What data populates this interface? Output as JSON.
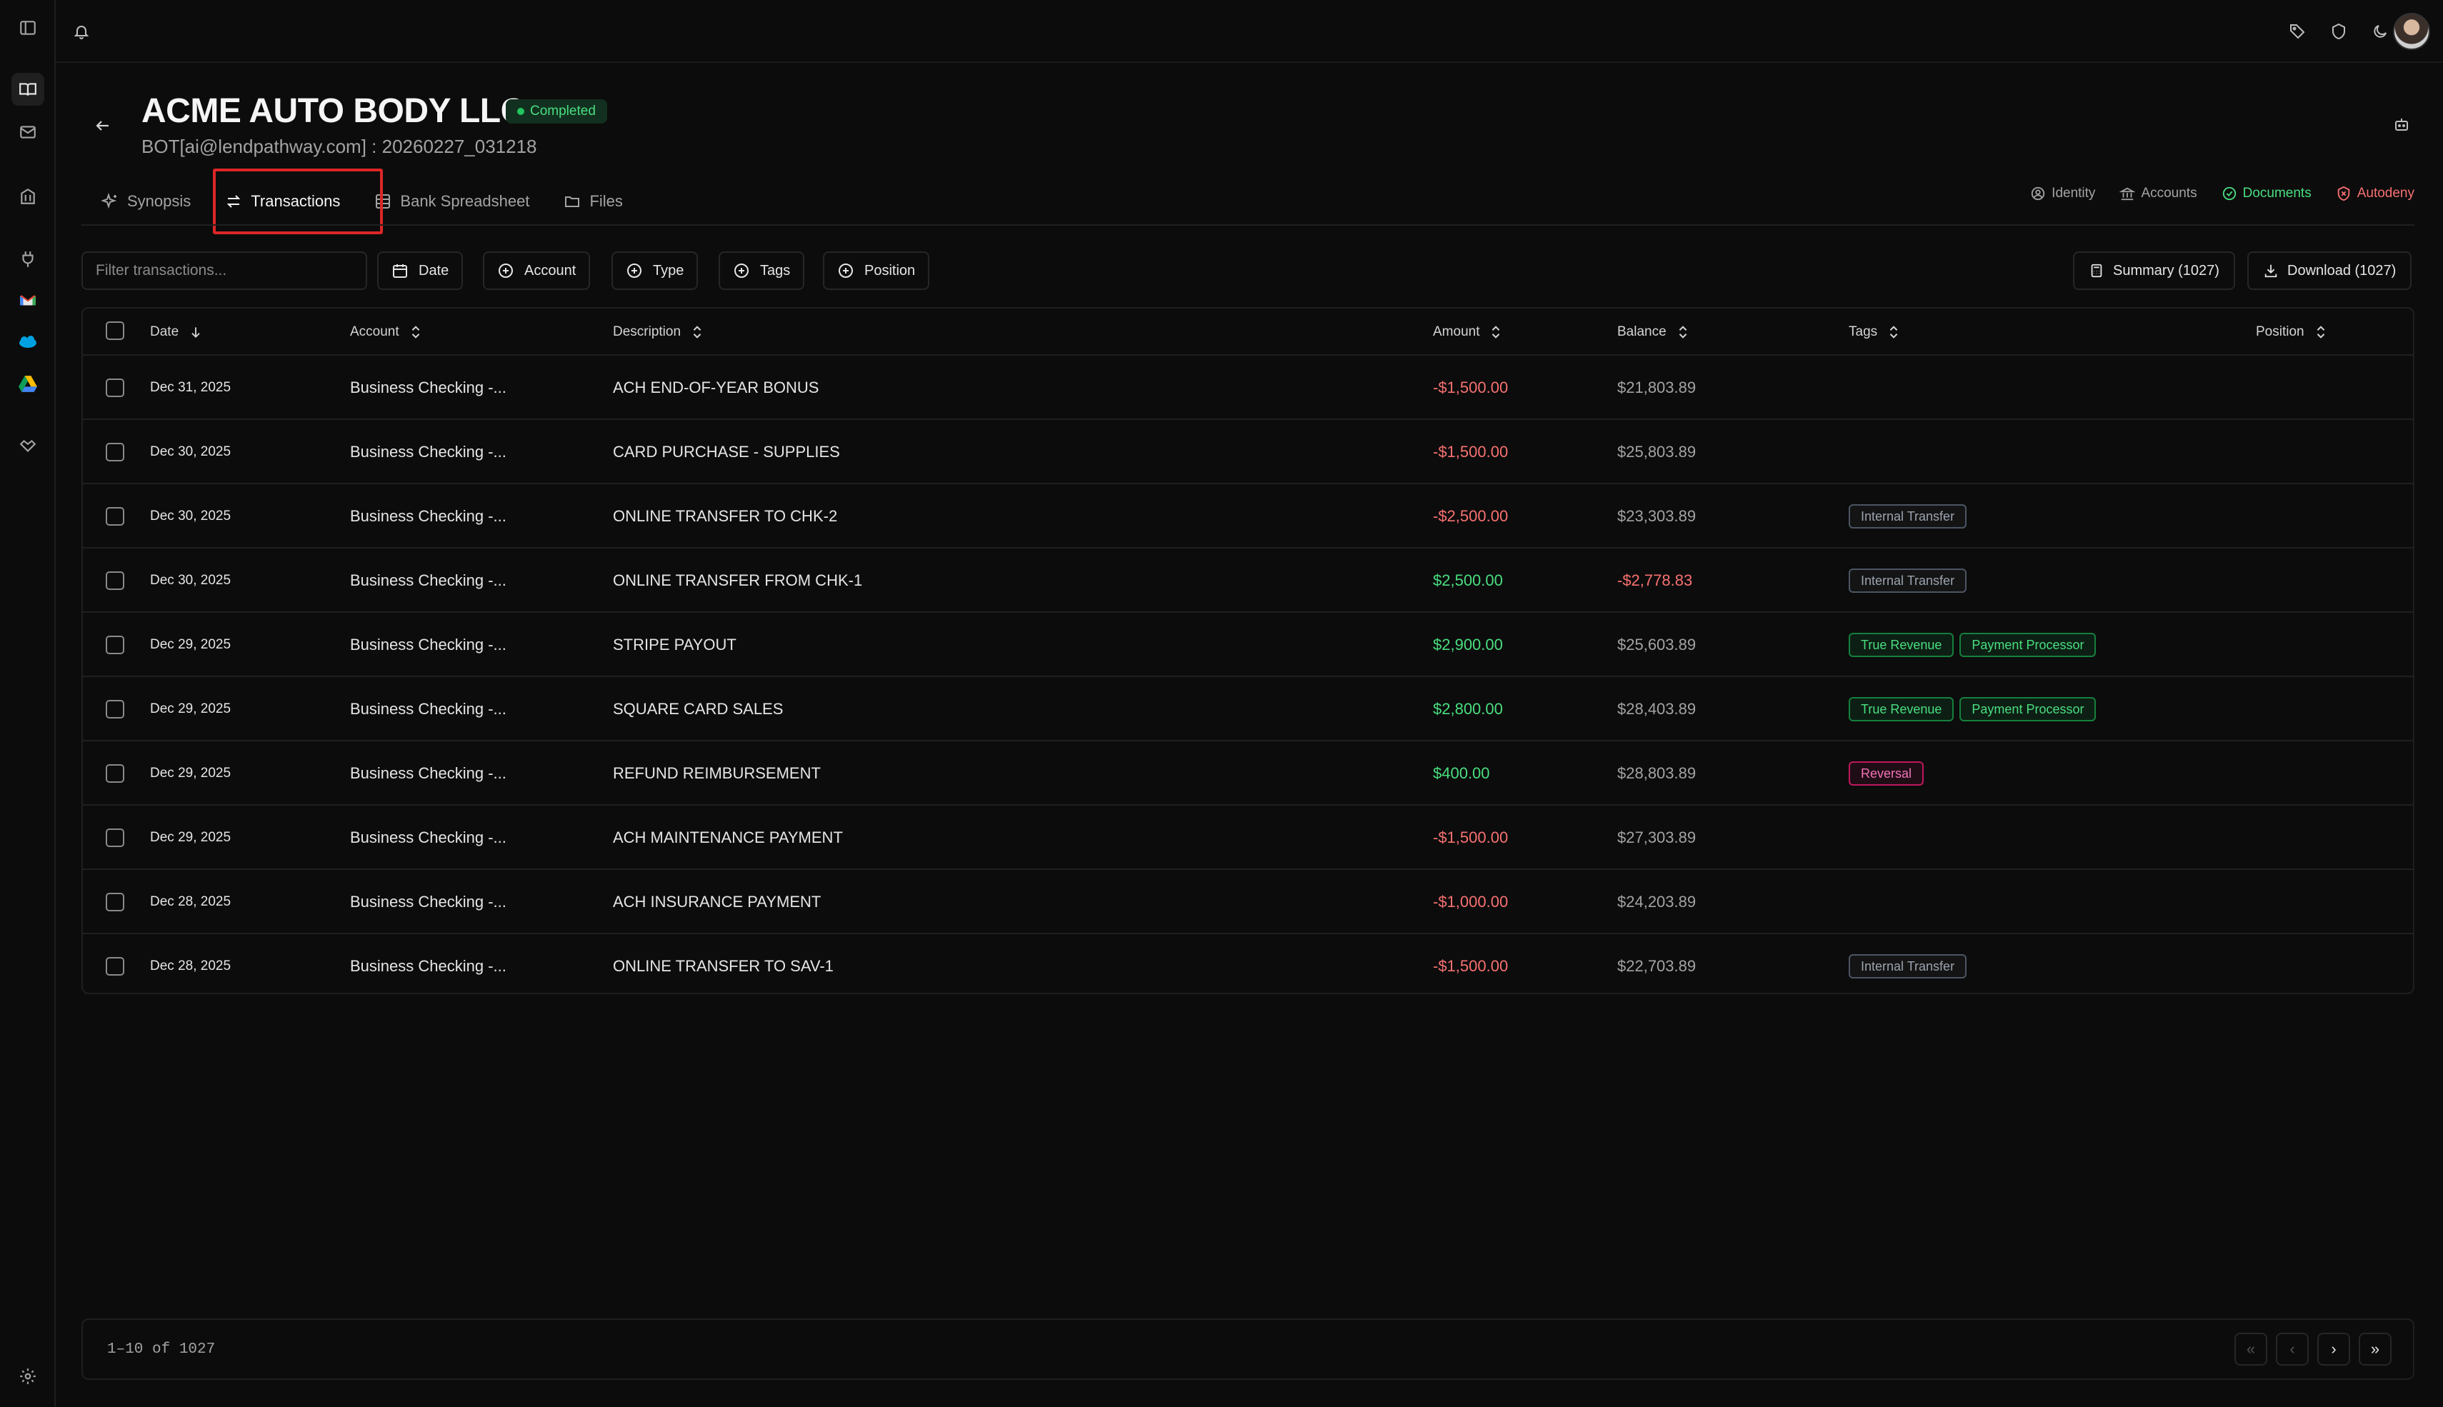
{
  "header": {
    "title": "ACME AUTO BODY LLC",
    "status_badge": "Completed",
    "subtitle": "BOT[ai@lendpathway.com] : 20260227_031218"
  },
  "tabs": [
    {
      "label": "Synopsis",
      "icon": "sparkles-icon"
    },
    {
      "label": "Transactions",
      "icon": "arrows-swap-icon",
      "active": true
    },
    {
      "label": "Bank Spreadsheet",
      "icon": "table-icon"
    },
    {
      "label": "Files",
      "icon": "folder-icon"
    }
  ],
  "status_links": [
    {
      "label": "Identity",
      "icon": "user-circle-icon",
      "color": "#a3a3a3"
    },
    {
      "label": "Accounts",
      "icon": "bank-icon",
      "color": "#a3a3a3"
    },
    {
      "label": "Documents",
      "icon": "check-circle-icon",
      "color": "#4ade80"
    },
    {
      "label": "Autodeny",
      "icon": "shield-x-icon",
      "color": "#f87171"
    }
  ],
  "filters": {
    "search_placeholder": "Filter transactions...",
    "chips": [
      "Date",
      "Account",
      "Type",
      "Tags",
      "Position"
    ],
    "summary_label": "Summary (1027)",
    "download_label": "Download (1027)"
  },
  "table": {
    "columns": [
      "Date",
      "Account",
      "Description",
      "Amount",
      "Balance",
      "Tags",
      "Position"
    ],
    "rows": [
      {
        "date": "Dec 31, 2025",
        "account": "Business Checking -...",
        "description": "ACH END-OF-YEAR BONUS",
        "amount": "-$1,500.00",
        "amount_sign": "neg",
        "balance": "$21,803.89",
        "balance_sign": "pos",
        "tags": []
      },
      {
        "date": "Dec 30, 2025",
        "account": "Business Checking -...",
        "description": "CARD PURCHASE - SUPPLIES",
        "amount": "-$1,500.00",
        "amount_sign": "neg",
        "balance": "$25,803.89",
        "balance_sign": "pos",
        "tags": []
      },
      {
        "date": "Dec 30, 2025",
        "account": "Business Checking -...",
        "description": "ONLINE TRANSFER TO CHK-2",
        "amount": "-$2,500.00",
        "amount_sign": "neg",
        "balance": "$23,303.89",
        "balance_sign": "pos",
        "tags": [
          {
            "label": "Internal Transfer",
            "style": "gray"
          }
        ]
      },
      {
        "date": "Dec 30, 2025",
        "account": "Business Checking -...",
        "description": "ONLINE TRANSFER FROM CHK-1",
        "amount": "$2,500.00",
        "amount_sign": "pos",
        "balance": "-$2,778.83",
        "balance_sign": "neg",
        "tags": [
          {
            "label": "Internal Transfer",
            "style": "gray"
          }
        ]
      },
      {
        "date": "Dec 29, 2025",
        "account": "Business Checking -...",
        "description": "STRIPE PAYOUT",
        "amount": "$2,900.00",
        "amount_sign": "pos",
        "balance": "$25,603.89",
        "balance_sign": "pos",
        "tags": [
          {
            "label": "True Revenue",
            "style": "green"
          },
          {
            "label": "Payment Processor",
            "style": "green"
          }
        ]
      },
      {
        "date": "Dec 29, 2025",
        "account": "Business Checking -...",
        "description": "SQUARE CARD SALES",
        "amount": "$2,800.00",
        "amount_sign": "pos",
        "balance": "$28,403.89",
        "balance_sign": "pos",
        "tags": [
          {
            "label": "True Revenue",
            "style": "green"
          },
          {
            "label": "Payment Processor",
            "style": "green"
          }
        ]
      },
      {
        "date": "Dec 29, 2025",
        "account": "Business Checking -...",
        "description": "REFUND REIMBURSEMENT",
        "amount": "$400.00",
        "amount_sign": "pos",
        "balance": "$28,803.89",
        "balance_sign": "pos",
        "tags": [
          {
            "label": "Reversal",
            "style": "pink"
          }
        ]
      },
      {
        "date": "Dec 29, 2025",
        "account": "Business Checking -...",
        "description": "ACH MAINTENANCE PAYMENT",
        "amount": "-$1,500.00",
        "amount_sign": "neg",
        "balance": "$27,303.89",
        "balance_sign": "pos",
        "tags": []
      },
      {
        "date": "Dec 28, 2025",
        "account": "Business Checking -...",
        "description": "ACH INSURANCE PAYMENT",
        "amount": "-$1,000.00",
        "amount_sign": "neg",
        "balance": "$24,203.89",
        "balance_sign": "pos",
        "tags": []
      },
      {
        "date": "Dec 28, 2025",
        "account": "Business Checking -...",
        "description": "ONLINE TRANSFER TO SAV-1",
        "amount": "-$1,500.00",
        "amount_sign": "neg",
        "balance": "$22,703.89",
        "balance_sign": "pos",
        "tags": [
          {
            "label": "Internal Transfer",
            "style": "gray"
          }
        ]
      }
    ]
  },
  "pagination": {
    "text": "1–10 of 1027",
    "buttons": [
      "«",
      "‹",
      "›",
      "»"
    ]
  },
  "colors": {
    "negative": "#f87171",
    "positive": "#4ade80",
    "tab_highlight": "#dc2626",
    "background": "#0c0c0c"
  }
}
